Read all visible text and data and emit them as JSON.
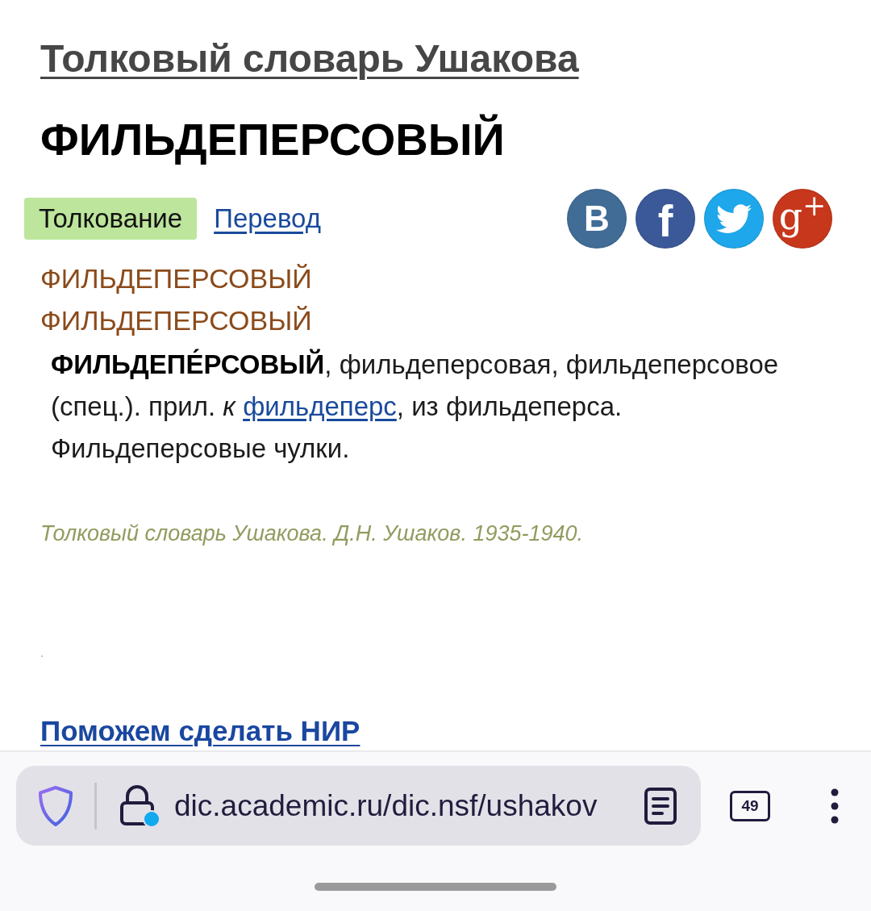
{
  "page": {
    "dictionary_title": "Толковый словарь Ушакова",
    "headword": "ФИЛЬДЕПЕРСОВЫЙ",
    "tabs": [
      {
        "label": "Толкование",
        "selected": true
      },
      {
        "label": "Перевод",
        "selected": false
      }
    ],
    "share_buttons": [
      {
        "kind": "letter",
        "label": "В",
        "color": "#416c96"
      },
      {
        "kind": "letter",
        "label": "f",
        "color": "#3b5998"
      },
      {
        "kind": "bird",
        "color": "#1ea7ea"
      },
      {
        "kind": "letter",
        "label": "g$^{+}$",
        "color": "#c7371b"
      }
    ],
    "entry_titles": [
      "ФИЛЬДЕПЕРСОВЫЙ",
      "ФИЛЬДЕПЕРСОВЫЙ"
    ],
    "definition": [
      {
        "kind": "text",
        "text": "**ФИЛЬДЕПЕ́РСОВЫЙ**, фильдеперсовая, фильдеперсовое (спец.). прил. *к* "
      },
      {
        "kind": "link",
        "text": "фильдеперс"
      },
      {
        "kind": "text",
        "text": ", из фильдеперса. Фильдеперсовые чулки."
      }
    ],
    "source": "Толковый словарь Ушакова. Д.Н. Ушаков. 1935-1940.",
    "separator": ".",
    "promo_link": "Поможем сделать НИР"
  },
  "browser": {
    "url": "dic.academic.ru/dic.nsf/ushakov",
    "tab_count": "49"
  }
}
